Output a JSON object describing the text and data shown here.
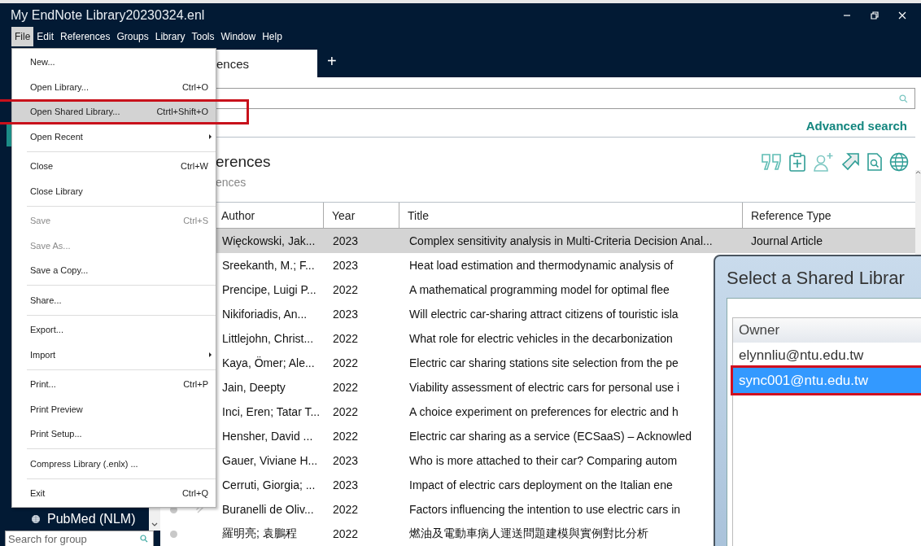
{
  "window": {
    "title": "My EndNote Library20230324.enl"
  },
  "menu_bar": [
    {
      "label": "File",
      "selected": true
    },
    {
      "label": "Edit",
      "selected": false
    },
    {
      "label": "References",
      "selected": false
    },
    {
      "label": "Groups",
      "selected": false
    },
    {
      "label": "Library",
      "selected": false
    },
    {
      "label": "Tools",
      "selected": false
    },
    {
      "label": "Window",
      "selected": false
    },
    {
      "label": "Help",
      "selected": false
    }
  ],
  "tabs": [
    {
      "label": "ences",
      "kind": "tab"
    },
    {
      "label": "+",
      "kind": "add"
    }
  ],
  "advanced_search": "Advanced search",
  "heading": "erences",
  "subheading": "ences",
  "table": {
    "columns": [
      "Author",
      "Year",
      "Title",
      "Reference Type"
    ],
    "rows": [
      {
        "author": "Więckowski, Jak...",
        "year": "2023",
        "title": "Complex sensitivity analysis in Multi-Criteria Decision Anal...",
        "type": "Journal Article",
        "selected": true
      },
      {
        "author": "Sreekanth, M.; F...",
        "year": "2023",
        "title": "Heat load estimation and thermodynamic analysis of",
        "selected": false
      },
      {
        "author": "Prencipe, Luigi P...",
        "year": "2022",
        "title": "A mathematical programming model for optimal flee",
        "selected": false
      },
      {
        "author": "Nikiforiadis, An...",
        "year": "2023",
        "title": "Will electric car-sharing attract citizens of touristic isla",
        "selected": false
      },
      {
        "author": "Littlejohn, Christ...",
        "year": "2022",
        "title": "What role for electric vehicles in the decarbonization",
        "selected": false
      },
      {
        "author": "Kaya, Ömer; Ale...",
        "year": "2022",
        "title": "Electric car sharing stations site selection from the pe",
        "selected": false
      },
      {
        "author": "Jain, Deepty",
        "year": "2022",
        "title": "Viability assessment of electric cars for personal use i",
        "selected": false
      },
      {
        "author": "Inci, Eren; Tatar T...",
        "year": "2022",
        "title": "A choice experiment on preferences for electric and h",
        "selected": false
      },
      {
        "author": "Hensher, David ...",
        "year": "2022",
        "title": "Electric car sharing as a service (ECSaaS) – Acknowled",
        "selected": false
      },
      {
        "author": "Gauer, Viviane H...",
        "year": "2023",
        "title": "Who is more attached to their car? Comparing autom",
        "selected": false
      },
      {
        "author": "Cerruti, Giorgia; ...",
        "year": "2023",
        "title": "Impact of electric cars deployment on the Italian ene",
        "selected": false
      },
      {
        "author": "Buranelli de Oliv...",
        "year": "2022",
        "title": "Factors influencing the intention to use electric cars in",
        "selected": false,
        "dot": true,
        "attachment": true
      },
      {
        "author": "羅明亮; 袁鵬程",
        "year": "2022",
        "title": "燃油及電動車病人運送問題建模與實例對比分析",
        "selected": false,
        "dot": true
      }
    ]
  },
  "sidebar": {
    "items": [
      {
        "label": "PubMed (NLM)"
      }
    ],
    "search": {
      "placeholder": "Search for group"
    }
  },
  "file_menu": [
    {
      "kind": "item",
      "label": "New...",
      "selected": false,
      "disabled": false
    },
    {
      "kind": "item",
      "label": "Open Library...",
      "shortcut": "Ctrl+O",
      "selected": false,
      "disabled": false
    },
    {
      "kind": "item",
      "label": "Open Shared Library...",
      "shortcut": "Ctrtl+Shift+O",
      "selected": true,
      "disabled": false,
      "highlighted": true
    },
    {
      "kind": "item",
      "label": "Open Recent",
      "submenu": true,
      "selected": false,
      "disabled": false
    },
    {
      "kind": "separator"
    },
    {
      "kind": "item",
      "label": "Close",
      "shortcut": "Ctrl+W",
      "selected": false,
      "disabled": false
    },
    {
      "kind": "item",
      "label": "Close Library",
      "selected": false,
      "disabled": false
    },
    {
      "kind": "separator"
    },
    {
      "kind": "item",
      "label": "Save",
      "shortcut": "Ctrl+S",
      "selected": false,
      "disabled": true
    },
    {
      "kind": "item",
      "label": "Save As...",
      "selected": false,
      "disabled": true
    },
    {
      "kind": "item",
      "label": "Save a Copy...",
      "selected": false,
      "disabled": false
    },
    {
      "kind": "separator"
    },
    {
      "kind": "item",
      "label": "Share...",
      "selected": false,
      "disabled": false
    },
    {
      "kind": "separator"
    },
    {
      "kind": "item",
      "label": "Export...",
      "selected": false,
      "disabled": false
    },
    {
      "kind": "item",
      "label": "Import",
      "submenu": true,
      "selected": false,
      "disabled": false
    },
    {
      "kind": "separator"
    },
    {
      "kind": "item",
      "label": "Print...",
      "shortcut": "Ctrl+P",
      "selected": false,
      "disabled": false
    },
    {
      "kind": "item",
      "label": "Print Preview",
      "selected": false,
      "disabled": false
    },
    {
      "kind": "item",
      "label": "Print Setup...",
      "selected": false,
      "disabled": false
    },
    {
      "kind": "separator"
    },
    {
      "kind": "item",
      "label": "Compress Library (.enlx) ...",
      "selected": false,
      "disabled": false
    },
    {
      "kind": "separator"
    },
    {
      "kind": "item",
      "label": "Exit",
      "shortcut": "Ctrl+Q",
      "selected": false,
      "disabled": false
    }
  ],
  "dialog": {
    "title": "Select a Shared Librar",
    "column": "Owner",
    "rows": [
      {
        "owner": "elynnliu@ntu.edu.tw",
        "selected": false,
        "highlighted": false
      },
      {
        "owner": "sync001@ntu.edu.tw",
        "selected": true,
        "highlighted": true
      }
    ]
  }
}
